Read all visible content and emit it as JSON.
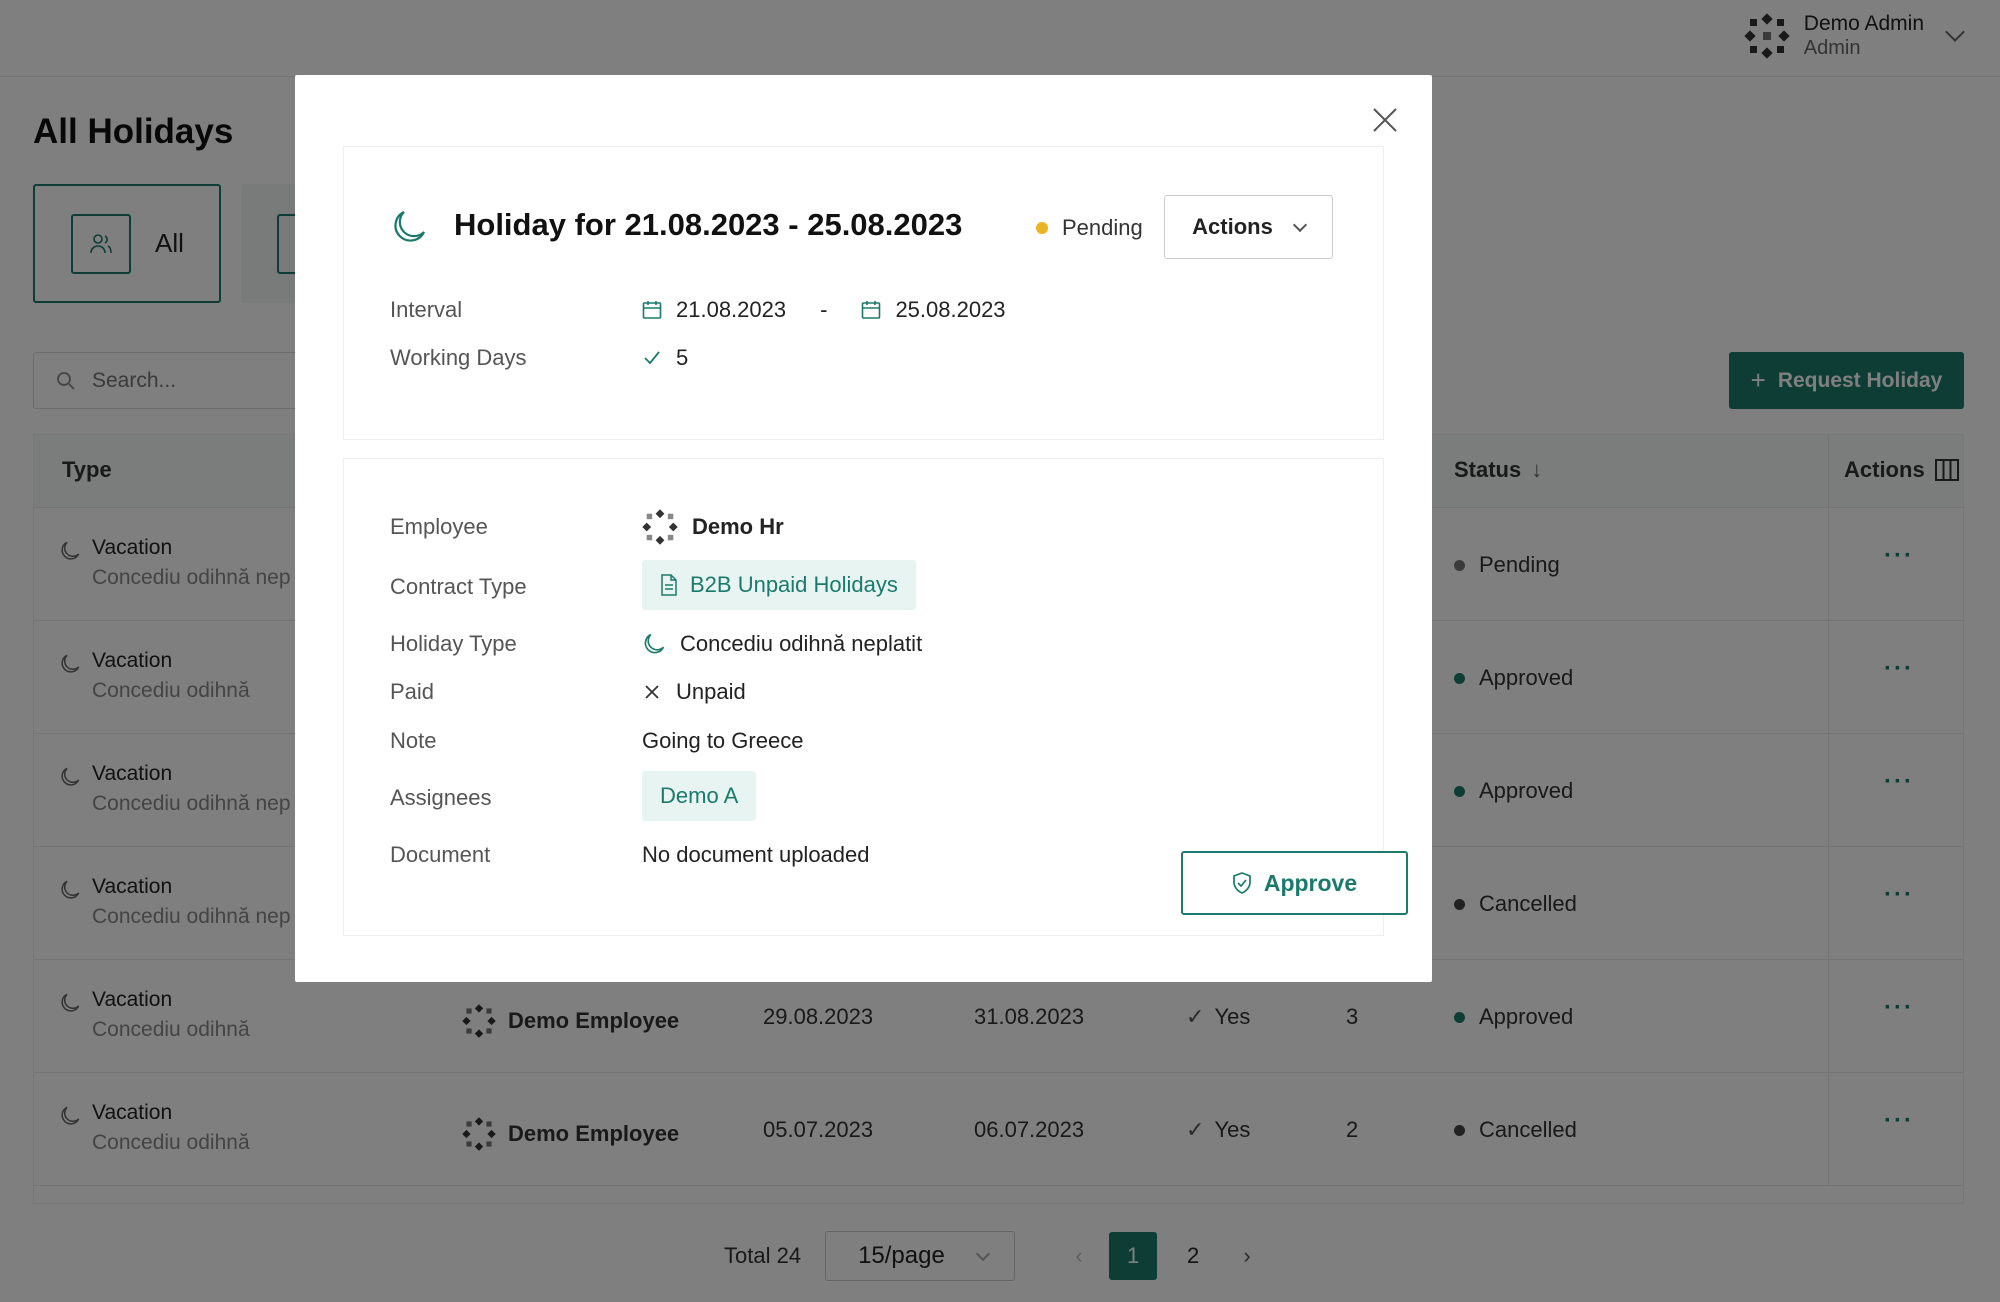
{
  "header": {
    "user_name": "Demo Admin",
    "user_role": "Admin"
  },
  "page": {
    "title": "All Holidays",
    "filter_all_label": "All",
    "search_placeholder": "Search...",
    "request_button_label": "Request Holiday"
  },
  "table": {
    "columns": {
      "type": "Type",
      "status": "Status",
      "actions": "Actions"
    },
    "rows": [
      {
        "type": "Vacation",
        "subtype": "Concediu odihnă nep",
        "employee": "",
        "start": "",
        "end": "",
        "paid": "",
        "days": "",
        "status": "Pending",
        "status_color": "#777777"
      },
      {
        "type": "Vacation",
        "subtype": "Concediu odihnă",
        "employee": "",
        "start": "",
        "end": "",
        "paid": "",
        "days": "",
        "status": "Approved",
        "status_color": "#1b7a6b"
      },
      {
        "type": "Vacation",
        "subtype": "Concediu odihnă nep",
        "employee": "",
        "start": "",
        "end": "",
        "paid": "",
        "days": "",
        "status": "Approved",
        "status_color": "#1b7a6b"
      },
      {
        "type": "Vacation",
        "subtype": "Concediu odihnă nep",
        "employee": "",
        "start": "",
        "end": "",
        "paid": "",
        "days": "",
        "status": "Cancelled",
        "status_color": "#444444"
      },
      {
        "type": "Vacation",
        "subtype": "Concediu odihnă",
        "employee": "Demo Employee",
        "start": "29.08.2023",
        "end": "31.08.2023",
        "paid": "Yes",
        "days": "3",
        "status": "Approved",
        "status_color": "#1b7a6b"
      },
      {
        "type": "Vacation",
        "subtype": "Concediu odihnă",
        "employee": "Demo Employee",
        "start": "05.07.2023",
        "end": "06.07.2023",
        "paid": "Yes",
        "days": "2",
        "status": "Cancelled",
        "status_color": "#444444"
      }
    ],
    "row_actions_glyph": "···"
  },
  "pagination": {
    "total": "Total 24",
    "page_size": "15/page",
    "pages": [
      "1",
      "2"
    ],
    "current": "1"
  },
  "modal": {
    "title": "Holiday for 21.08.2023 - 25.08.2023",
    "status": "Pending",
    "status_color": "#e9b425",
    "actions_label": "Actions",
    "interval_label": "Interval",
    "interval_start": "21.08.2023",
    "interval_sep": "-",
    "interval_end": "25.08.2023",
    "working_days_label": "Working Days",
    "working_days": "5",
    "employee_label": "Employee",
    "employee": "Demo Hr",
    "contract_type_label": "Contract Type",
    "contract_type": "B2B Unpaid Holidays",
    "holiday_type_label": "Holiday Type",
    "holiday_type": "Concediu odihnă neplatit",
    "paid_label": "Paid",
    "paid": "Unpaid",
    "note_label": "Note",
    "note": "Going to Greece",
    "assignees_label": "Assignees",
    "assignee": "Demo A",
    "document_label": "Document",
    "document": "No document uploaded",
    "approve_label": "Approve"
  },
  "colors": {
    "accent": "#1b7a6b",
    "pending": "#e9b425"
  }
}
